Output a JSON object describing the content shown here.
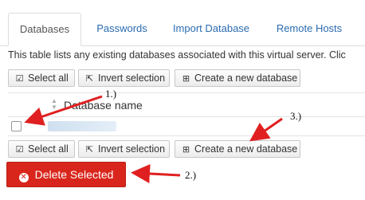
{
  "tabs": [
    {
      "label": "Databases",
      "active": true
    },
    {
      "label": "Passwords",
      "active": false
    },
    {
      "label": "Import Database",
      "active": false
    },
    {
      "label": "Remote Hosts",
      "active": false
    }
  ],
  "description": "This table lists any existing databases associated with this virtual server. Clic",
  "toolbar": {
    "select_all": "Select all",
    "invert_selection": "Invert selection",
    "create_database": "Create a new database"
  },
  "table": {
    "column_header": "Database name",
    "rows": [
      {
        "name": "",
        "checked": false
      }
    ]
  },
  "delete_button": "Delete Selected",
  "annotations": {
    "step1": "1.)",
    "step2": "2.)",
    "step3": "3.)"
  },
  "colors": {
    "accent_link": "#2b6cb0",
    "danger": "#d9261c",
    "annotation_arrow": "#e02020"
  }
}
